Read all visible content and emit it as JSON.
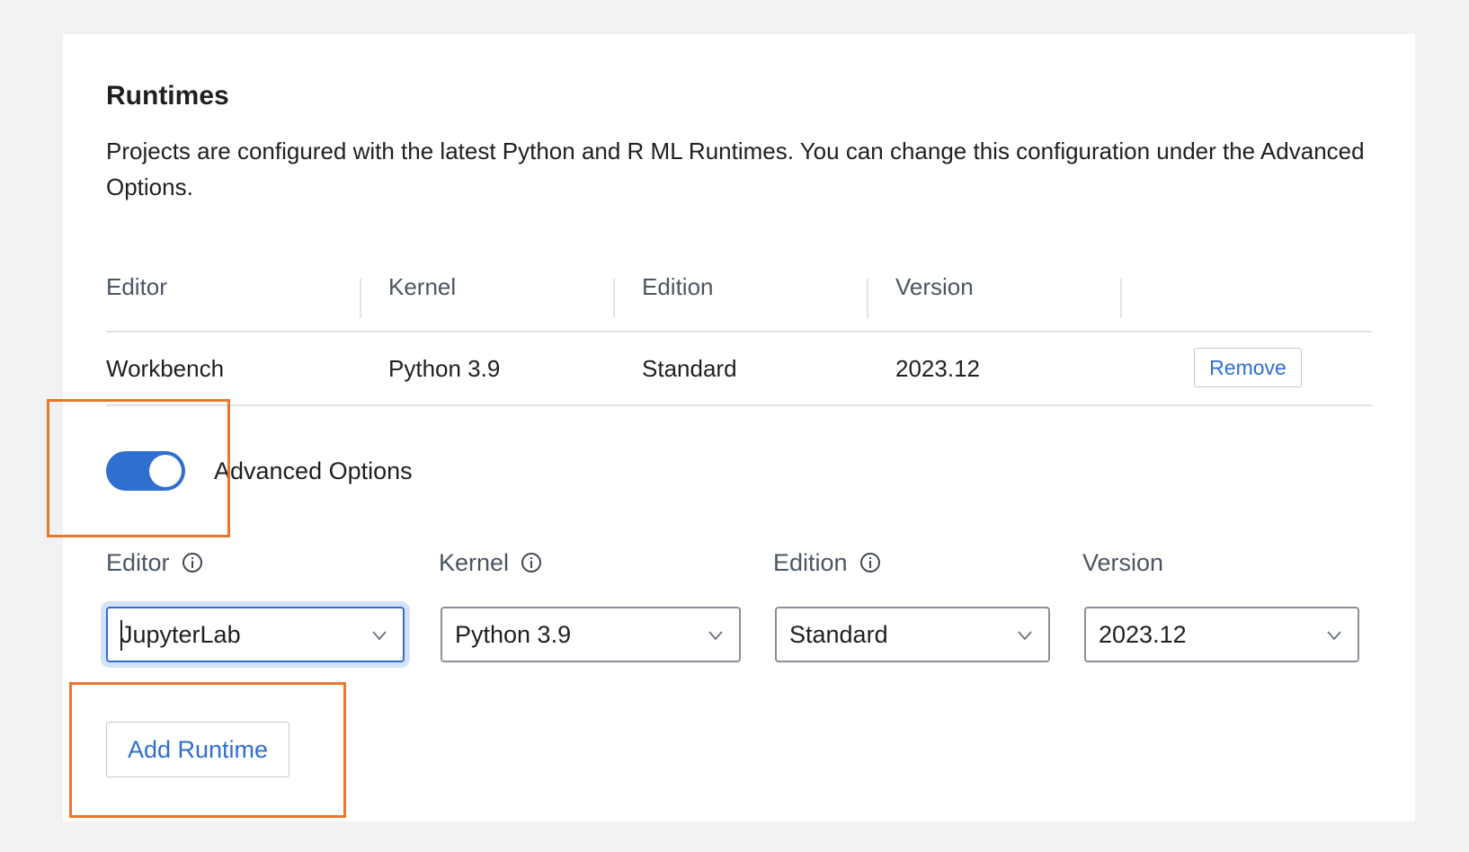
{
  "section": {
    "title": "Runtimes",
    "description": "Projects are configured with the latest Python and R ML Runtimes. You can change this configuration under the Advanced Options."
  },
  "table": {
    "headers": [
      "Editor",
      "Kernel",
      "Edition",
      "Version"
    ],
    "rows": [
      {
        "editor": "Workbench",
        "kernel": "Python 3.9",
        "edition": "Standard",
        "version": "2023.12",
        "action": "Remove"
      }
    ]
  },
  "advanced": {
    "label": "Advanced Options",
    "enabled": true
  },
  "form": {
    "editor": {
      "label": "Editor",
      "value": "JupyterLab"
    },
    "kernel": {
      "label": "Kernel",
      "value": "Python 3.9"
    },
    "edition": {
      "label": "Edition",
      "value": "Standard"
    },
    "version": {
      "label": "Version",
      "value": "2023.12"
    }
  },
  "add_button": "Add Runtime",
  "colors": {
    "accent": "#2f6fcf",
    "highlight": "#e8772e",
    "background": "#f1f2f4"
  },
  "icons": [
    "info-icon",
    "chevron-down-icon"
  ]
}
